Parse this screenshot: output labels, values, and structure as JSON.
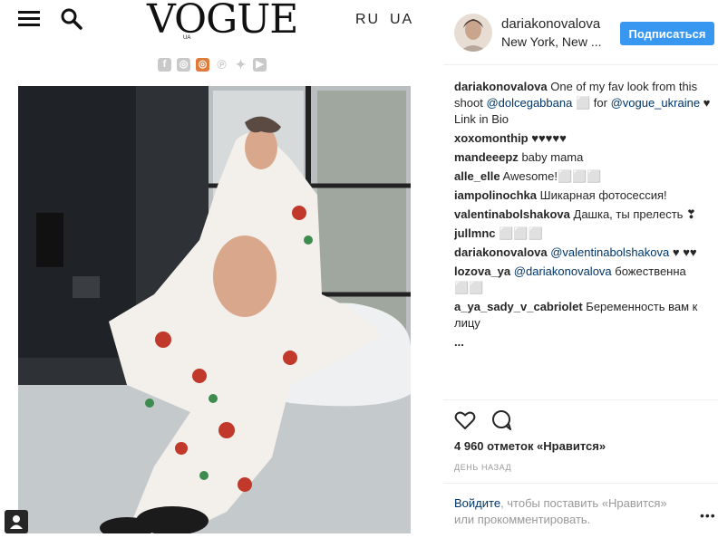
{
  "header": {
    "logo_text": "VOGUE",
    "logo_sub": "UA",
    "lang_ru": "RU",
    "lang_ua": "UA",
    "social_icons": [
      "facebook-icon",
      "instagram-icon",
      "instagram-active-icon",
      "pinterest-icon",
      "twitter-icon",
      "youtube-icon"
    ]
  },
  "post": {
    "username": "dariakonovalova",
    "location": "New York, New ...",
    "follow_label": "Подписаться",
    "caption": {
      "user": "dariakonovalova",
      "text1": "One of my fav look from this shoot",
      "mention1": "@dolcegabbana",
      "text2": "⬜ for",
      "mention2": "@vogue_ukraine",
      "text3": "♥ Link in Bio"
    },
    "comments": [
      {
        "user": "xoxomonthip",
        "text": "♥♥♥♥♥"
      },
      {
        "user": "mandeeepz",
        "text": "baby mama"
      },
      {
        "user": "alle_elle",
        "text": "Awesome!⬜⬜⬜"
      },
      {
        "user": "iampolinochka",
        "text": "Шикарная фотосессия!"
      },
      {
        "user": "valentinabolshakova",
        "text": "Дашка, ты прелесть ❣"
      },
      {
        "user": "jullmnc",
        "text": "⬜⬜⬜"
      },
      {
        "user": "dariakonovalova",
        "mention": "@valentinabolshakova",
        "text": "♥ ♥♥"
      },
      {
        "user": "lozova_ya",
        "mention": "@dariakonovalova",
        "text": "божественна ⬜⬜"
      },
      {
        "user": "a_ya_sady_v_cabriolet",
        "text": "Беременность вам к лицу"
      },
      {
        "user": "...",
        "text": ""
      }
    ],
    "likes": "4 960 отметок «Нравится»",
    "time_ago": "ДЕНЬ НАЗАД",
    "login_link": "Войдите",
    "login_text": ", чтобы поставить «Нравится» или прокомментировать.",
    "more_label": "•••"
  },
  "colors": {
    "follow_button": "#3897f0",
    "link": "#003569",
    "social_active": "#e07b3c",
    "social_inactive": "#c9c9c9"
  }
}
